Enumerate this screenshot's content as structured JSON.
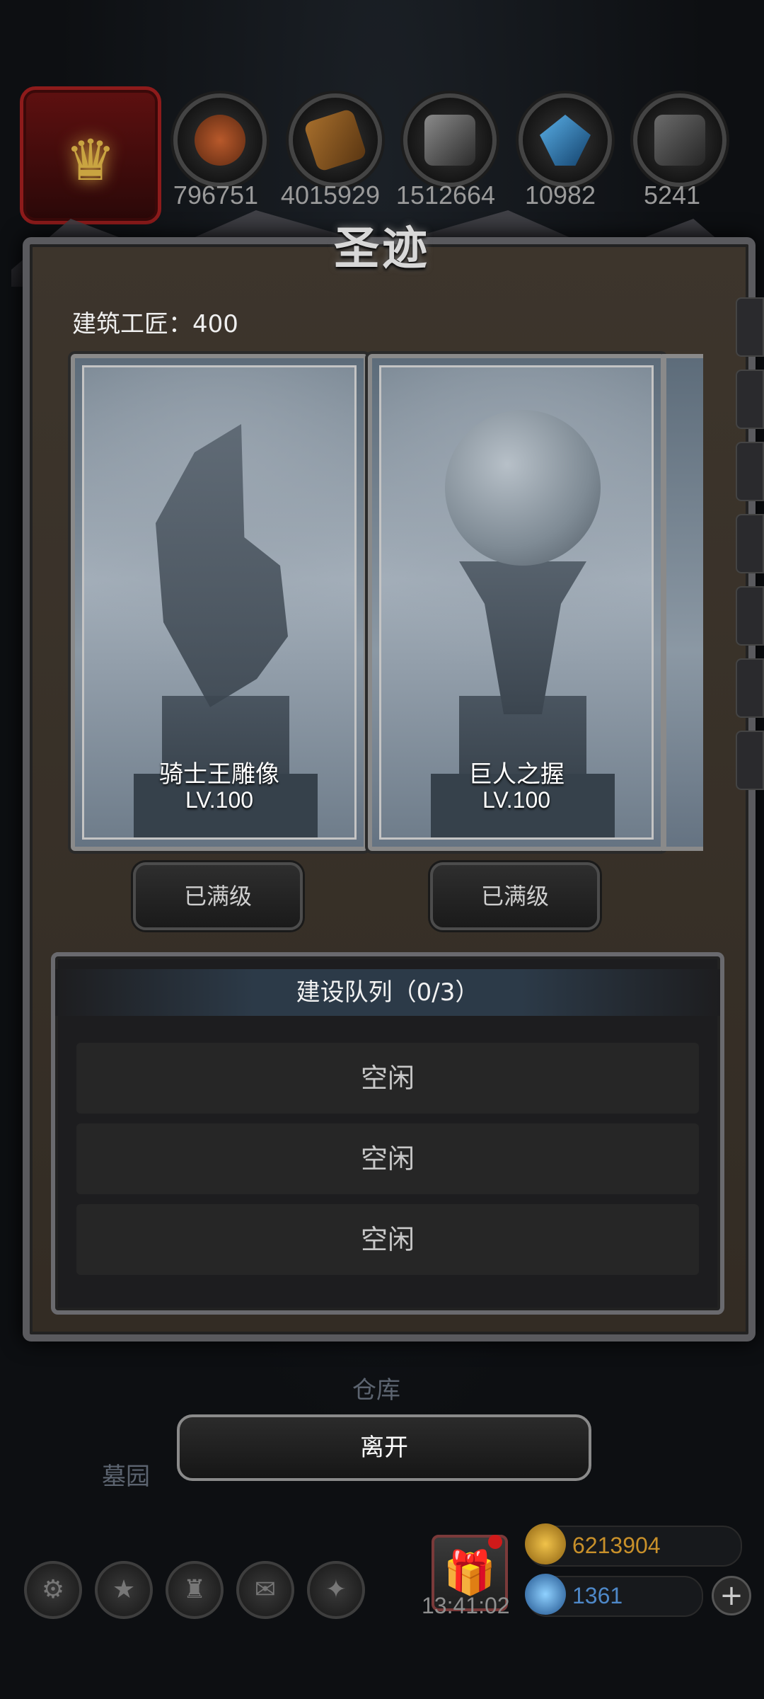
{
  "resources": [
    {
      "name": "food",
      "value": "796751"
    },
    {
      "name": "wood",
      "value": "4015929"
    },
    {
      "name": "iron",
      "value": "1512664"
    },
    {
      "name": "crystal",
      "value": "10982"
    },
    {
      "name": "stone",
      "value": "5241"
    }
  ],
  "panel": {
    "title": "圣迹",
    "builder_label": "建筑工匠：",
    "builder_value": "400",
    "leave_label": "离开"
  },
  "relics": [
    {
      "name": "骑士王雕像",
      "level": "LV.100",
      "status": "已满级"
    },
    {
      "name": "巨人之握",
      "level": "LV.100",
      "status": "已满级"
    }
  ],
  "queue": {
    "label": "建设队列",
    "count": "（0/3）",
    "slots": [
      "空闲",
      "空闲",
      "空闲"
    ]
  },
  "map": {
    "warehouse": "仓库",
    "cemetery": "墓园"
  },
  "bottom": {
    "timer": "13:41:02",
    "gold": "6213904",
    "gems": "1361"
  }
}
